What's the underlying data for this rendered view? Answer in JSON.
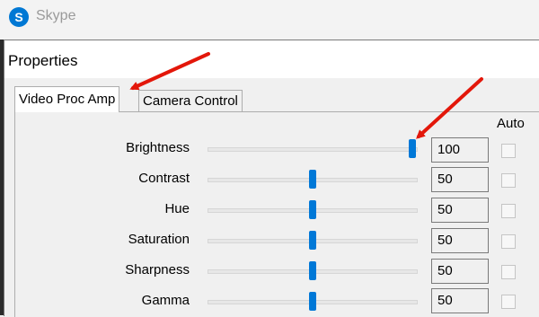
{
  "app": {
    "name": "Skype",
    "logo_letter": "S"
  },
  "dialog": {
    "title": "Properties",
    "tabs": [
      {
        "label": "Video Proc Amp",
        "active": true
      },
      {
        "label": "Camera Control",
        "active": false
      }
    ],
    "auto_header": "Auto",
    "controls": [
      {
        "label": "Brightness",
        "value": "100",
        "fraction": 1.0,
        "auto": false
      },
      {
        "label": "Contrast",
        "value": "50",
        "fraction": 0.5,
        "auto": false
      },
      {
        "label": "Hue",
        "value": "50",
        "fraction": 0.5,
        "auto": false
      },
      {
        "label": "Saturation",
        "value": "50",
        "fraction": 0.5,
        "auto": false
      },
      {
        "label": "Sharpness",
        "value": "50",
        "fraction": 0.5,
        "auto": false
      },
      {
        "label": "Gamma",
        "value": "50",
        "fraction": 0.5,
        "auto": false
      }
    ]
  },
  "colors": {
    "accent": "#0078d7",
    "annotation": "#e3170a"
  }
}
